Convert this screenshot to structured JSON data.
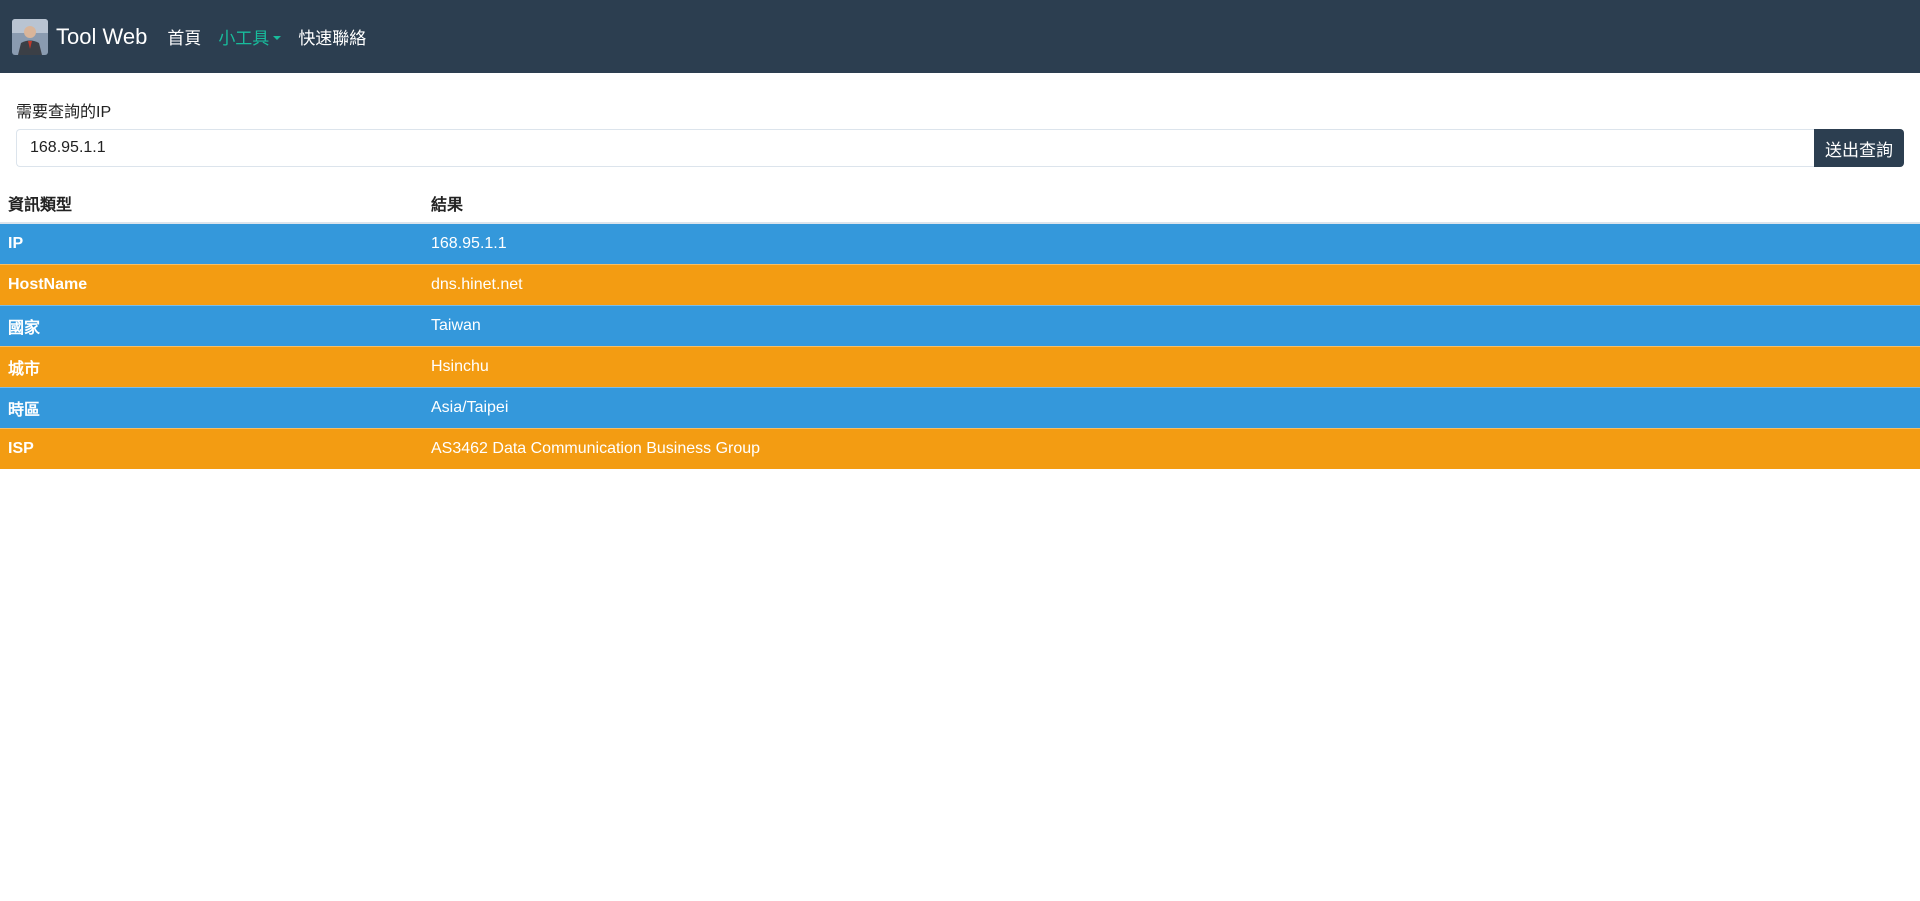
{
  "navbar": {
    "brand_title": "Tool Web",
    "items": [
      {
        "label": "首頁",
        "active": false
      },
      {
        "label": "小工具",
        "active": true,
        "dropdown": true
      },
      {
        "label": "快速聯絡",
        "active": false
      }
    ]
  },
  "form": {
    "label": "需要查詢的IP",
    "input_value": "168.95.1.1",
    "submit_label": "送出查詢"
  },
  "table": {
    "headers": [
      "資訊類型",
      "結果"
    ],
    "rows": [
      {
        "type": "IP",
        "value": "168.95.1.1"
      },
      {
        "type": "HostName",
        "value": "dns.hinet.net"
      },
      {
        "type": "國家",
        "value": "Taiwan"
      },
      {
        "type": "城市",
        "value": "Hsinchu"
      },
      {
        "type": "時區",
        "value": "Asia/Taipei"
      },
      {
        "type": "ISP",
        "value": "AS3462 Data Communication Business Group"
      }
    ]
  },
  "colors": {
    "navbar_bg": "#2c3e50",
    "nav_active": "#18bc9c",
    "row_info": "#3498db",
    "row_warning": "#f39c12"
  }
}
